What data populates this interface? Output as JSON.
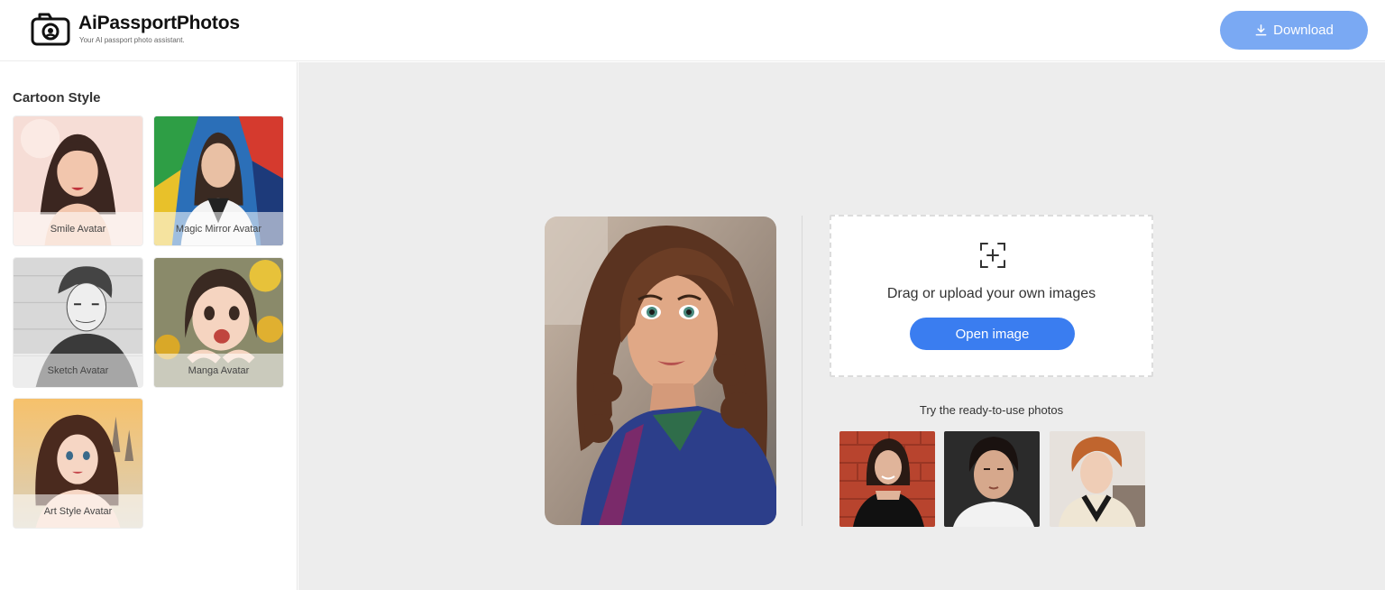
{
  "header": {
    "brand_name": "AiPassportPhotos",
    "tagline": "Your AI passport photo assistant.",
    "download_label": "Download"
  },
  "sidebar": {
    "section_title": "Cartoon Style",
    "styles": [
      {
        "label": "Smile Avatar"
      },
      {
        "label": "Magic Mirror Avatar"
      },
      {
        "label": "Sketch Avatar"
      },
      {
        "label": "Manga Avatar"
      },
      {
        "label": "Art Style Avatar"
      }
    ]
  },
  "main": {
    "upload_text": "Drag or upload your own images",
    "open_button": "Open image",
    "try_text": "Try the ready-to-use photos"
  },
  "colors": {
    "primary": "#3a7df0",
    "download_button": "#7aa9f3",
    "main_background": "#ededed"
  }
}
